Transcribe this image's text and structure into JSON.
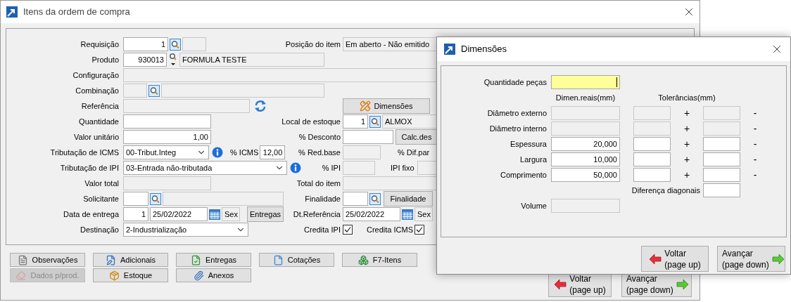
{
  "main_window": {
    "title": "Itens da ordem de compra",
    "rows": [
      {
        "label": "Requisição",
        "items": [
          {
            "kind": "field",
            "value": "1",
            "disabled": false
          },
          {
            "kind": "lookup"
          },
          {
            "kind": "field",
            "disabled": true
          }
        ],
        "right": {
          "label": "Posição do item",
          "items": [
            {
              "kind": "field",
              "value": "Em aberto - Não emitido",
              "disabled": true
            }
          ]
        }
      },
      {
        "label": "Produto",
        "items": [
          {
            "kind": "field",
            "value": "930013",
            "disabled": false
          },
          {
            "kind": "lookup_menu"
          },
          {
            "kind": "field",
            "value": "FORMULA TESTE",
            "disabled": true
          }
        ]
      },
      {
        "label": "Configuração",
        "items": [
          {
            "kind": "field",
            "disabled": true
          }
        ]
      },
      {
        "label": "Combinação",
        "items": [
          {
            "kind": "field",
            "disabled": true
          },
          {
            "kind": "lookup"
          },
          {
            "kind": "field",
            "disabled": true
          }
        ]
      },
      {
        "label": "Referência",
        "items": [
          {
            "kind": "field",
            "disabled": true
          },
          {
            "kind": "refresh"
          }
        ],
        "right": {
          "items": [
            {
              "kind": "button",
              "text": "Dimensões"
            }
          ]
        }
      },
      {
        "label": "Quantidade",
        "items": [
          {
            "kind": "field",
            "disabled": false
          }
        ],
        "right": {
          "label": "Local de estoque",
          "items": [
            {
              "kind": "field",
              "value": "1",
              "disabled": false
            },
            {
              "kind": "lookup"
            },
            {
              "kind": "field",
              "value": "ALMOX",
              "disabled": true
            }
          ]
        }
      },
      {
        "label": "Valor unitário",
        "items": [
          {
            "kind": "field",
            "value": "1,00",
            "disabled": false
          }
        ],
        "right": {
          "label": "% Desconto",
          "items": [
            {
              "kind": "field",
              "disabled": false
            },
            {
              "kind": "button",
              "text": "Calc.des"
            }
          ]
        }
      },
      {
        "label": "Tributação de ICMS",
        "items": [
          {
            "kind": "select",
            "value": "00-Tribut.Integ"
          },
          {
            "kind": "info"
          },
          {
            "kind": "label",
            "text": "% ICMS"
          },
          {
            "kind": "field",
            "value": "12,00",
            "disabled": false
          }
        ],
        "right": {
          "label": "% Red.base",
          "items": [
            {
              "kind": "field",
              "disabled": true
            },
            {
              "kind": "label",
              "text": "% Dif.par"
            }
          ]
        }
      },
      {
        "label": "Tributação de IPI",
        "items": [
          {
            "kind": "select",
            "value": "03-Entrada não-tributada"
          },
          {
            "kind": "info"
          }
        ],
        "right": {
          "label": "% IPI",
          "items": [
            {
              "kind": "field",
              "disabled": true
            },
            {
              "kind": "label",
              "text": "IPI fixo"
            },
            {
              "kind": "field",
              "disabled": true
            }
          ]
        }
      },
      {
        "label": "Valor total",
        "items": [
          {
            "kind": "field",
            "disabled": true
          }
        ],
        "right": {
          "label": "Total do item",
          "items": [
            {
              "kind": "field",
              "disabled": true
            }
          ]
        }
      },
      {
        "label": "Solicitante",
        "items": [
          {
            "kind": "field",
            "disabled": false
          },
          {
            "kind": "lookup"
          },
          {
            "kind": "field",
            "disabled": true
          }
        ],
        "right": {
          "label": "Finalidade",
          "items": [
            {
              "kind": "field",
              "disabled": false
            },
            {
              "kind": "lookup"
            },
            {
              "kind": "button",
              "text": "Finalidade"
            }
          ]
        }
      },
      {
        "label": "Data de entrega",
        "items": [
          {
            "kind": "field",
            "value": "1",
            "disabled": false
          },
          {
            "kind": "field",
            "value": "25/02/2022",
            "disabled": false
          },
          {
            "kind": "calendar"
          },
          {
            "kind": "field",
            "value": "Sex",
            "disabled": true
          },
          {
            "kind": "button",
            "text": "Entregas"
          }
        ],
        "right": {
          "label": "Dt.Referência",
          "items": [
            {
              "kind": "field",
              "value": "25/02/2022",
              "disabled": false
            },
            {
              "kind": "calendar"
            },
            {
              "kind": "field",
              "value": "Sex",
              "disabled": true
            }
          ]
        }
      },
      {
        "label": "Destinação",
        "items": [
          {
            "kind": "select",
            "value": "2-Industrialização"
          }
        ],
        "right": {
          "label": "Credita IPI",
          "items": [
            {
              "kind": "checkbox",
              "checked": true
            },
            {
              "kind": "label",
              "text": "Credita ICMS"
            },
            {
              "kind": "checkbox",
              "checked": true
            }
          ]
        }
      }
    ],
    "buttons": [
      {
        "label": "Observações",
        "disabled": false
      },
      {
        "label": "Adicionais",
        "disabled": false
      },
      {
        "label": "Entregas",
        "disabled": false
      },
      {
        "label": "Cotações",
        "disabled": false
      },
      {
        "label": "F7-Itens",
        "disabled": false
      },
      {
        "label": "Dados p/prod.",
        "disabled": true
      },
      {
        "label": "Estoque",
        "disabled": false
      },
      {
        "label": "Anexos",
        "disabled": false
      }
    ],
    "nav_buttons": [
      {
        "label": "Voltar",
        "hint": "(page up)"
      },
      {
        "label": "Avançar",
        "hint": "(page down)"
      }
    ]
  },
  "dimensions_dialog": {
    "title": "Dimensões",
    "quantity": {
      "label": "Quantidade peças",
      "focused": true
    },
    "headers": [
      "Dimen.reais(mm)",
      "Tolerâncias(mm)"
    ],
    "rows": [
      {
        "label": "Diâmetro externo",
        "disabled": true,
        "tolerances": [
          {
            "sign": "+",
            "disabled": true
          },
          {
            "sign": "-",
            "disabled": true
          }
        ]
      },
      {
        "label": "Diâmetro interno",
        "disabled": true,
        "tolerances": [
          {
            "sign": "+",
            "disabled": true
          },
          {
            "sign": "-",
            "disabled": true
          }
        ]
      },
      {
        "label": "Espessura",
        "value": "20,000",
        "disabled": false,
        "tolerances": [
          {
            "sign": "+",
            "disabled": false
          },
          {
            "sign": "-",
            "disabled": false
          }
        ]
      },
      {
        "label": "Largura",
        "value": "10,000",
        "disabled": false,
        "tolerances": [
          {
            "sign": "+",
            "disabled": false
          },
          {
            "sign": "-",
            "disabled": false
          }
        ]
      },
      {
        "label": "Comprimento",
        "value": "50,000",
        "disabled": false,
        "tolerances": [
          {
            "sign": "+",
            "disabled": false
          },
          {
            "sign": "-",
            "disabled": false
          }
        ]
      }
    ],
    "diagonal": {
      "label": "Diferença diagonais",
      "disabled": false
    },
    "volume": {
      "label": "Volume",
      "disabled": true
    },
    "buttons": [
      {
        "label": "Voltar",
        "hint": "(page up)"
      },
      {
        "label": "Avançar",
        "hint": "(page down)"
      }
    ]
  }
}
